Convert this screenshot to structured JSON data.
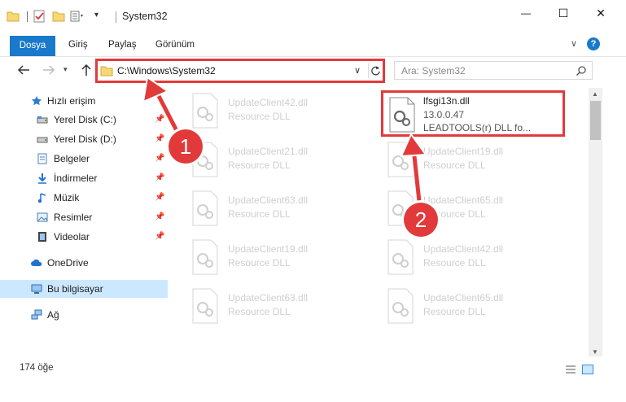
{
  "window": {
    "title": "System32",
    "minimize_label": "—",
    "maximize_label": "☐",
    "close_label": "✕"
  },
  "quick_access": {
    "dropdown_label": "▾"
  },
  "ribbon": {
    "tabs": [
      {
        "label": "Dosya"
      },
      {
        "label": "Giriş"
      },
      {
        "label": "Paylaş"
      },
      {
        "label": "Görünüm"
      }
    ],
    "expand_label": "∨",
    "help_label": "?"
  },
  "nav": {
    "recent_label": "▾",
    "address": "C:\\Windows\\System32",
    "address_dropdown": "∨",
    "search_placeholder": "Ara: System32"
  },
  "sidebar": {
    "items": [
      {
        "label": "Hızlı erişim",
        "icon": "star-icon",
        "pinned": false
      },
      {
        "label": "Yerel Disk (C:)",
        "icon": "drive-icon",
        "pinned": true
      },
      {
        "label": "Yerel Disk (D:)",
        "icon": "drive-icon",
        "pinned": true
      },
      {
        "label": "Belgeler",
        "icon": "documents-icon",
        "pinned": true
      },
      {
        "label": "İndirmeler",
        "icon": "download-icon",
        "pinned": true
      },
      {
        "label": "Müzik",
        "icon": "music-icon",
        "pinned": true
      },
      {
        "label": "Resimler",
        "icon": "pictures-icon",
        "pinned": true
      },
      {
        "label": "Videolar",
        "icon": "video-icon",
        "pinned": true
      },
      {
        "label": "OneDrive",
        "icon": "cloud-icon",
        "pinned": false
      },
      {
        "label": "Bu bilgisayar",
        "icon": "computer-icon",
        "pinned": false
      },
      {
        "label": "Ağ",
        "icon": "network-icon",
        "pinned": false
      }
    ]
  },
  "files": {
    "left_column": [
      {
        "name": "UpdateClient42.dll",
        "desc": "Resource DLL"
      },
      {
        "name": "UpdateClient21.dll",
        "desc": "Resource DLL"
      },
      {
        "name": "UpdateClient63.dll",
        "desc": "Resource DLL"
      },
      {
        "name": "UpdateClient19.dll",
        "desc": "Resource DLL"
      },
      {
        "name": "UpdateClient63.dll",
        "desc": "Resource DLL"
      }
    ],
    "right_column": [
      {
        "name": "UpdateClient19.dll",
        "desc": "Resource DLL"
      },
      {
        "name": "UpdateClient65.dll",
        "desc": "Resource DLL"
      },
      {
        "name": "UpdateClient42.dll",
        "desc": "Resource DLL"
      },
      {
        "name": "UpdateClient65.dll",
        "desc": "Resource DLL"
      }
    ],
    "selected": {
      "name": "lfsgi13n.dll",
      "version": "13.0.0.47",
      "desc": "LEADTOOLS(r) DLL fo..."
    }
  },
  "status": {
    "item_count": "174 öğe"
  },
  "annotations": {
    "step1": "1",
    "step2": "2",
    "color": "#e23a3a"
  },
  "colors": {
    "accent": "#1979ca",
    "selection": "#cce8ff"
  }
}
